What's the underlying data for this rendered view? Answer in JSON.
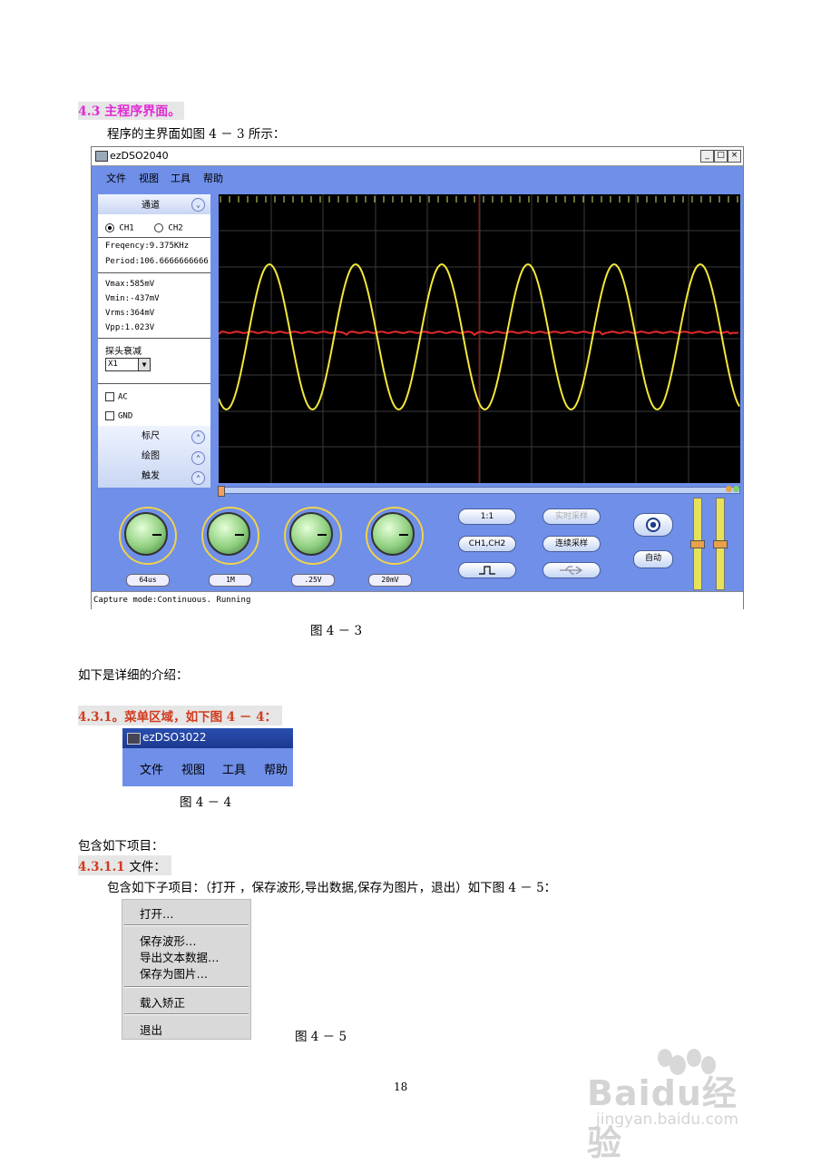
{
  "section_4_3": {
    "number": "4.3",
    "title": "主程序界面。"
  },
  "intro_line": "程序的主界面如图 4 － 3 所示：",
  "main_window": {
    "title": "ezDSO2040",
    "menus": [
      "文件",
      "视图",
      "工具",
      "帮助"
    ],
    "panel": {
      "channel_header": "通道",
      "ch1": "CH1",
      "ch2": "CH2",
      "frequency": "Freqency:9.375KHz",
      "period": "Period:106.6666666666",
      "vmax": "Vmax:585mV",
      "vmin": "Vmin:-437mV",
      "vrms": "Vrms:364mV",
      "vpp": "Vpp:1.023V",
      "probe_label": "探头衰减",
      "probe_value": "X1",
      "ac": "AC",
      "gnd": "GND",
      "ruler": "标尺",
      "draw": "绘图",
      "trigger": "触发"
    },
    "knob_labels": [
      "64us",
      "1M",
      ".25V",
      "20mV"
    ],
    "buttons": {
      "ratio": "1:1",
      "channels": "CH1,CH2",
      "realtime": "实时采样",
      "continuous": "连续采样",
      "auto": "自动"
    },
    "status": "Capture mode:Continuous. Running"
  },
  "fig_4_3": "图 4 － 3",
  "detail_intro": "如下是详细的介绍：",
  "section_4_3_1": {
    "number": "4.3.1。",
    "title": "菜单区域，如下图 4 － 4："
  },
  "mini_window": {
    "title": "ezDSO3022",
    "menus": [
      "文件",
      "视图",
      "工具",
      "帮助"
    ]
  },
  "fig_4_4": "图 4 － 4",
  "includes": "包含如下项目：",
  "section_4_3_1_1": {
    "number": "4.3.1.1",
    "title": "文件："
  },
  "sub_items_line": "包含如下子项目：（打开 ，保存波形,导出数据,保存为图片，退出）如下图 4 － 5：",
  "dropdown_items": [
    "打开…",
    "保存波形…",
    "导出文本数据…",
    "保存为图片…",
    "载入矫正",
    "退出"
  ],
  "fig_4_5": "图 4 － 5",
  "page_number": "18",
  "watermark": {
    "brand": "Baidu经验",
    "url": "jingyan.baidu.com"
  },
  "colors": {
    "heading_pink": "#e02ad4",
    "heading_red": "#d23b1e",
    "app_blue": "#6f8fe8",
    "trace_yellow": "#f2e83a",
    "trace_red": "#e62a2a"
  }
}
